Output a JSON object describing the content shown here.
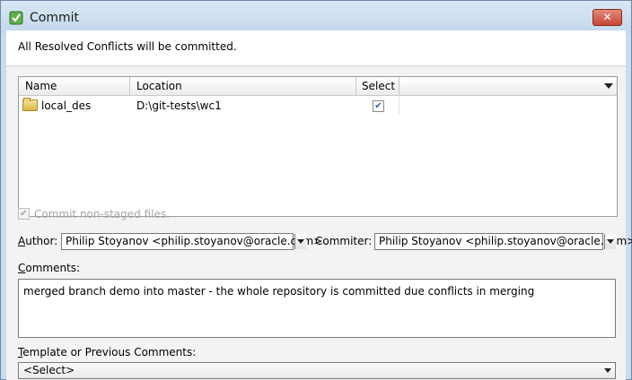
{
  "window": {
    "title": "Commit",
    "close_glyph": "✕"
  },
  "header": {
    "message": "All Resolved Conflicts will be committed."
  },
  "table": {
    "columns": [
      "Name",
      "Location",
      "Select"
    ],
    "rows": [
      {
        "name": "local_des",
        "location": "D:\\git-tests\\wc1",
        "selected": true,
        "check_glyph": "✔"
      }
    ]
  },
  "nonstaged": {
    "label": "Commit non-staged files.",
    "checked": true,
    "enabled": false,
    "check_glyph": "✔"
  },
  "author": {
    "label_prefix": "A",
    "label_rest": "uthor:",
    "value": "Philip Stoyanov <philip.stoyanov@oracle.com>"
  },
  "committer": {
    "label": "Commiter:",
    "value": "Philip Stoyanov <philip.stoyanov@oracle.com>"
  },
  "comments": {
    "label_prefix": "C",
    "label_rest": "omments:",
    "value": "merged branch demo into master - the whole repository is committed due conflicts in merging"
  },
  "template": {
    "label_prefix": "T",
    "label_rest": "emplate or Previous Comments:",
    "selected": "<Select>"
  },
  "colors": {
    "title_bar": "#c3d7ec",
    "close_button": "#c64533",
    "accent": "#2b55a7"
  }
}
